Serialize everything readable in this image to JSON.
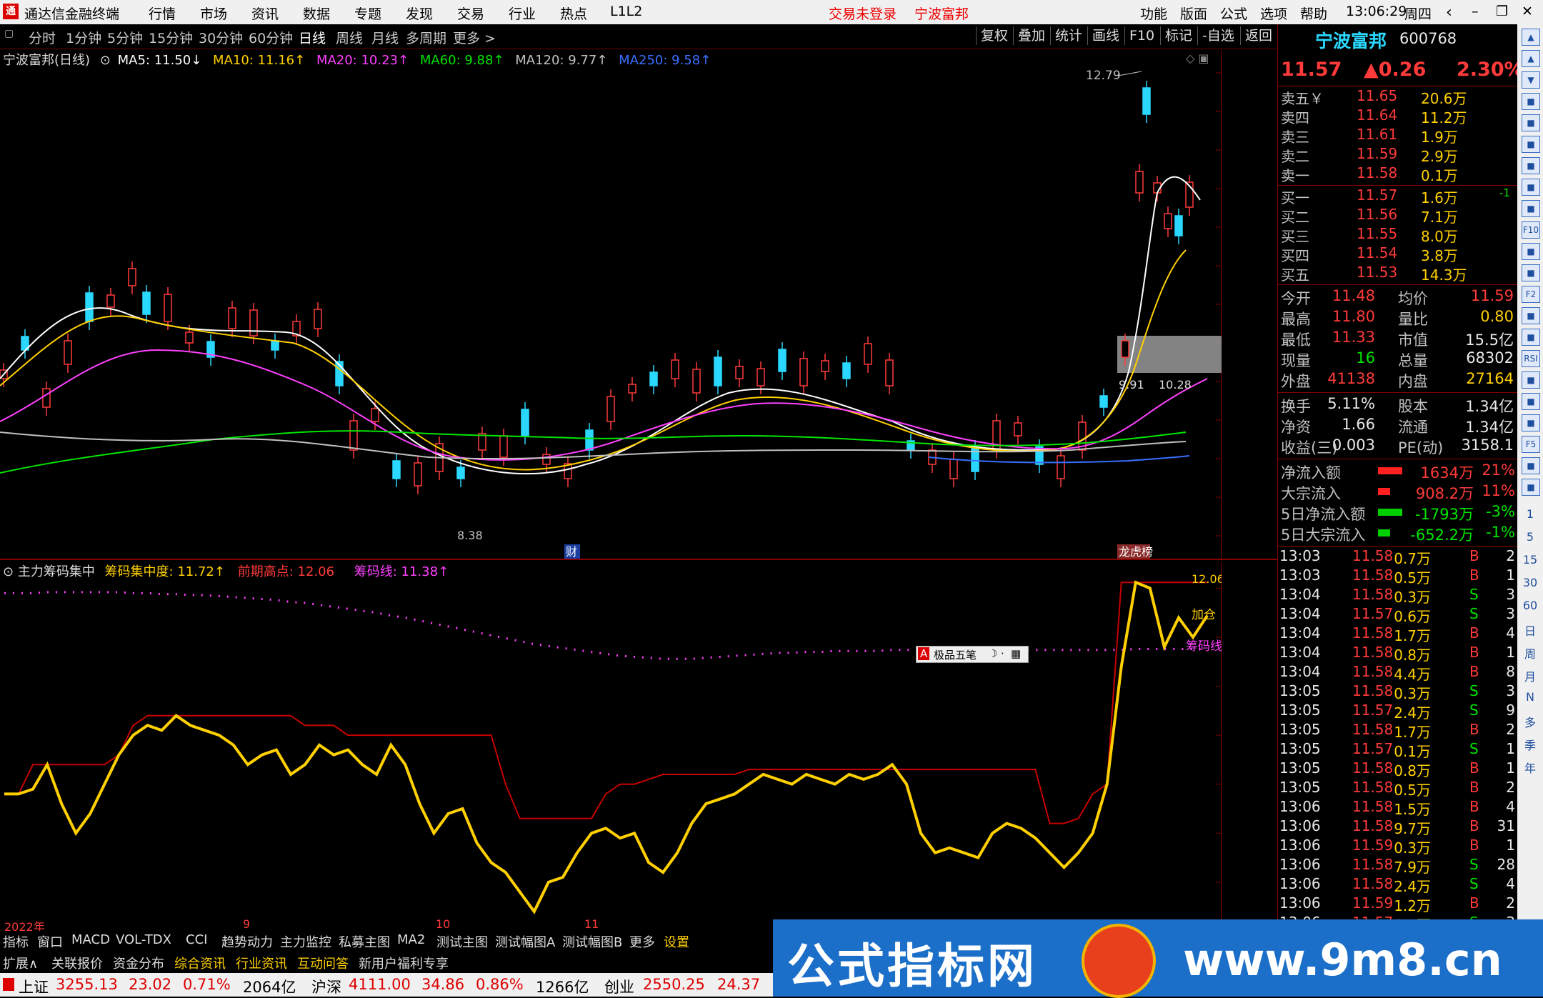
{
  "titlebar": {
    "app_name": "通达信金融终端",
    "menus": [
      "行情",
      "市场",
      "资讯",
      "数据",
      "专题",
      "发现",
      "交易",
      "行业",
      "热点",
      "L1L2"
    ],
    "notice_login": "交易未登录",
    "notice_stock": "宁波富邦",
    "right_menus": [
      "功能",
      "版面",
      "公式",
      "选项",
      "帮助"
    ],
    "time": "13:06:29",
    "weekday": "周四",
    "window_buttons": [
      "‹",
      "–",
      "❐",
      "✕"
    ]
  },
  "toolbar": {
    "periods": [
      "分时",
      "1分钟",
      "5分钟",
      "15分钟",
      "30分钟",
      "60分钟",
      "日线",
      "周线",
      "月线",
      "多周期",
      "更多 >"
    ],
    "active": "日线",
    "right_buttons": [
      "复权",
      "叠加",
      "统计",
      "画线",
      "F10",
      "标记",
      "-自选",
      "返回"
    ]
  },
  "main_chart": {
    "name": "宁波富邦(日线)",
    "ma": [
      {
        "label": "MA5: 11.50↓",
        "color": "#ffffff"
      },
      {
        "label": "MA10: 11.16↑",
        "color": "#ffd000"
      },
      {
        "label": "MA20: 10.23↑",
        "color": "#ff40ff"
      },
      {
        "label": "MA60: 9.88↑",
        "color": "#00e600"
      },
      {
        "label": "MA120: 9.77↑",
        "color": "#c0c0c0"
      },
      {
        "label": "MA250: 9.58↑",
        "color": "#3a6fff"
      }
    ],
    "high_label": "12.79",
    "low_label": "8.38",
    "box_label_left": "9.91",
    "box_label_right": "10.28",
    "event_cai": "财",
    "event_lhb": "龙虎榜",
    "y_ticks": [
      "12.50",
      "12.25",
      "12.00",
      "11.75",
      "11.50",
      "11.25",
      "11.00",
      "10.75",
      "10.50",
      "10.25",
      "10.00",
      "9.75",
      "9.50",
      "9.25",
      "9.00",
      "8.75",
      "8.50"
    ]
  },
  "indicator": {
    "name": "主力筹码集中",
    "chip_label": "筹码集中度: 11.72↑",
    "prev_high_label": "前期高点: 12.06",
    "chip_line_label": "筹码线: 11.38↑",
    "y_ticks": [
      "12.00",
      "11.50",
      "11.00",
      "10.50",
      "10.00",
      "9.50",
      "9.00"
    ],
    "end_label_top": "12.06",
    "end_label_add": "加仓",
    "end_label_line": "筹码线",
    "popup": "极品五笔"
  },
  "x_axis": {
    "labels": [
      "2022年",
      "9",
      "10",
      "11"
    ]
  },
  "quote": {
    "name": "宁波富邦",
    "code": "600768",
    "price": "11.57",
    "change": "▲0.26",
    "pct": "2.30%",
    "sells": [
      {
        "label": "卖五￥",
        "price": "11.65",
        "vol": "20.6万"
      },
      {
        "label": "卖四",
        "price": "11.64",
        "vol": "11.2万"
      },
      {
        "label": "卖三",
        "price": "11.61",
        "vol": "1.9万"
      },
      {
        "label": "卖二",
        "price": "11.59",
        "vol": "2.9万"
      },
      {
        "label": "卖一",
        "price": "11.58",
        "vol": "0.1万"
      }
    ],
    "buys": [
      {
        "label": "买一",
        "price": "11.57",
        "vol": "1.6万",
        "chg": "-1"
      },
      {
        "label": "买二",
        "price": "11.56",
        "vol": "7.1万",
        "chg": ""
      },
      {
        "label": "买三",
        "price": "11.55",
        "vol": "8.0万",
        "chg": ""
      },
      {
        "label": "买四",
        "price": "11.54",
        "vol": "3.8万",
        "chg": ""
      },
      {
        "label": "买五",
        "price": "11.53",
        "vol": "14.3万",
        "chg": ""
      }
    ],
    "stats": [
      {
        "l1": "今开",
        "v1": "11.48",
        "c1": "red",
        "l2": "均价",
        "v2": "11.59",
        "c2": "red"
      },
      {
        "l1": "最高",
        "v1": "11.80",
        "c1": "red",
        "l2": "量比",
        "v2": "0.80",
        "c2": "yel"
      },
      {
        "l1": "最低",
        "v1": "11.33",
        "c1": "red",
        "l2": "市值",
        "v2": "15.5亿",
        "c2": "wht"
      },
      {
        "l1": "现量",
        "v1": "16",
        "c1": "green",
        "l2": "总量",
        "v2": "68302",
        "c2": "wht"
      },
      {
        "l1": "外盘",
        "v1": "41138",
        "c1": "red",
        "l2": "内盘",
        "v2": "27164",
        "c2": "yel"
      }
    ],
    "stats2": [
      {
        "l1": "换手",
        "v1": "5.11%",
        "l2": "股本",
        "v2": "1.34亿"
      },
      {
        "l1": "净资",
        "v1": "1.66",
        "l2": "流通",
        "v2": "1.34亿"
      },
      {
        "l1": "收益(三)",
        "v1": "0.003",
        "l2": "PE(动)",
        "v2": "3158.1"
      }
    ],
    "flows": [
      {
        "label": "净流入额",
        "value": "1634万",
        "pct": "21%",
        "color": "red",
        "bar": 0.6
      },
      {
        "label": "大宗流入",
        "value": "908.2万",
        "pct": "11%",
        "color": "red",
        "bar": 0.3
      },
      {
        "label": "5日净流入额",
        "value": "-1793万",
        "pct": "-3%",
        "color": "green",
        "bar": 0.6
      },
      {
        "label": "5日大宗流入",
        "value": "-652.2万",
        "pct": "-1%",
        "color": "green",
        "bar": 0.3
      }
    ],
    "ticks": [
      {
        "t": "13:03",
        "p": "11.58",
        "v": "0.7万",
        "d": "B",
        "n": "2"
      },
      {
        "t": "13:03",
        "p": "11.58",
        "v": "0.5万",
        "d": "B",
        "n": "1"
      },
      {
        "t": "13:04",
        "p": "11.58",
        "v": "0.3万",
        "d": "S",
        "n": "3"
      },
      {
        "t": "13:04",
        "p": "11.57",
        "v": "0.6万",
        "d": "S",
        "n": "3"
      },
      {
        "t": "13:04",
        "p": "11.58",
        "v": "1.7万",
        "d": "B",
        "n": "4"
      },
      {
        "t": "13:04",
        "p": "11.58",
        "v": "0.8万",
        "d": "B",
        "n": "1"
      },
      {
        "t": "13:04",
        "p": "11.58",
        "v": "4.4万",
        "d": "B",
        "n": "8"
      },
      {
        "t": "13:05",
        "p": "11.58",
        "v": "0.3万",
        "d": "S",
        "n": "3"
      },
      {
        "t": "13:05",
        "p": "11.57",
        "v": "2.4万",
        "d": "S",
        "n": "9"
      },
      {
        "t": "13:05",
        "p": "11.58",
        "v": "1.7万",
        "d": "B",
        "n": "2"
      },
      {
        "t": "13:05",
        "p": "11.57",
        "v": "0.1万",
        "d": "S",
        "n": "1"
      },
      {
        "t": "13:05",
        "p": "11.58",
        "v": "0.8万",
        "d": "B",
        "n": "1"
      },
      {
        "t": "13:05",
        "p": "11.58",
        "v": "0.5万",
        "d": "B",
        "n": "2"
      },
      {
        "t": "13:06",
        "p": "11.58",
        "v": "1.5万",
        "d": "B",
        "n": "4"
      },
      {
        "t": "13:06",
        "p": "11.58",
        "v": "9.7万",
        "d": "B",
        "n": "31"
      },
      {
        "t": "13:06",
        "p": "11.59",
        "v": "0.3万",
        "d": "B",
        "n": "1"
      },
      {
        "t": "13:06",
        "p": "11.58",
        "v": "7.9万",
        "d": "S",
        "n": "28"
      },
      {
        "t": "13:06",
        "p": "11.58",
        "v": "2.4万",
        "d": "S",
        "n": "4"
      },
      {
        "t": "13:06",
        "p": "11.59",
        "v": "1.2万",
        "d": "B",
        "n": "2"
      },
      {
        "t": "13:06",
        "p": "11.57",
        "v": "0.5万",
        "d": "S",
        "n": "3"
      }
    ]
  },
  "side_icons": [
    "▲",
    "▲",
    "▼",
    "■",
    "■",
    "■",
    "■",
    "■",
    "■",
    "F10",
    "■",
    "■",
    "F2",
    "■",
    "■",
    "RSI",
    "■",
    "■",
    "■",
    "F5",
    "■",
    "■"
  ],
  "side_numbers": [
    "1",
    "5",
    "15",
    "30",
    "60",
    "日",
    "周",
    "月",
    "N",
    "多",
    "季",
    "年"
  ],
  "tabs1": [
    "指标",
    "窗口",
    "MACD",
    "VOL-TDX",
    "CCI",
    "趋势动力",
    "主力监控",
    "私募主图",
    "MA2",
    "测试主图",
    "测试幅图A",
    "测试幅图B",
    "更多",
    "设置"
  ],
  "tabs2": [
    {
      "label": "扩展∧",
      "color": "#ddd"
    },
    {
      "label": "关联报价",
      "color": "#ddd"
    },
    {
      "label": "资金分布",
      "color": "#ddd"
    },
    {
      "label": "综合资讯",
      "color": "#ffd000"
    },
    {
      "label": "行业资讯",
      "color": "#ffd000"
    },
    {
      "label": "互动问答",
      "color": "#ffd000"
    },
    {
      "label": "新用户福利专享",
      "color": "#ddd"
    }
  ],
  "status": {
    "sh_name": "上证",
    "sh_val": "3255.13",
    "sh_chg": "23.02",
    "sh_pct": "0.71%",
    "sh_amt": "2064亿",
    "hs_name": "沪深",
    "hs_val": "4111.00",
    "hs_chg": "34.86",
    "hs_pct": "0.86%",
    "hs_amt": "1266亿",
    "cy_name": "创业",
    "cy_val": "2550.25",
    "cy_chg": "24.37"
  },
  "watermark": {
    "cn": "公式指标网",
    "url": "www.9m8.cn"
  },
  "chart_data": {
    "type": "line",
    "title": "",
    "series": [
      {
        "name": "筹码集中度",
        "values": [
          9.9,
          9.9,
          9.95,
          10.2,
          9.8,
          9.5,
          9.7,
          10.0,
          10.3,
          10.5,
          10.6,
          10.55,
          10.7,
          10.6,
          10.55,
          10.5,
          10.4,
          10.2,
          10.3,
          10.35,
          10.1,
          10.2,
          10.4,
          10.3,
          10.35,
          10.2,
          10.1,
          10.4,
          10.2,
          9.8,
          9.5,
          9.7,
          9.75,
          9.4,
          9.2,
          9.1,
          8.9,
          8.7,
          9.0,
          9.05,
          9.3,
          9.5,
          9.55,
          9.45,
          9.5,
          9.2,
          9.1,
          9.3,
          9.6,
          9.8,
          9.85,
          9.9,
          10.0,
          10.1,
          10.05,
          10.0,
          10.1,
          10.05,
          10.0,
          10.1,
          10.05,
          10.1,
          10.2,
          10.0,
          9.5,
          9.3,
          9.35,
          9.3,
          9.25,
          9.5,
          9.6,
          9.55,
          9.45,
          9.3,
          9.15,
          9.3,
          9.5,
          10.0,
          11.2,
          12.06,
          12.0,
          11.4,
          11.7,
          11.5,
          11.72
        ]
      },
      {
        "name": "前期高点",
        "values": [
          9.9,
          9.9,
          10.2,
          10.2,
          10.2,
          10.2,
          10.2,
          10.2,
          10.3,
          10.6,
          10.7,
          10.7,
          10.7,
          10.7,
          10.7,
          10.7,
          10.7,
          10.7,
          10.7,
          10.7,
          10.7,
          10.6,
          10.6,
          10.6,
          10.5,
          10.5,
          10.5,
          10.5,
          10.5,
          10.5,
          10.5,
          10.5,
          10.5,
          10.5,
          10.5,
          10.0,
          9.65,
          9.65,
          9.65,
          9.65,
          9.65,
          9.65,
          9.9,
          10.0,
          10.0,
          10.05,
          10.1,
          10.1,
          10.1,
          10.1,
          10.1,
          10.1,
          10.15,
          10.15,
          10.15,
          10.15,
          10.15,
          10.15,
          10.15,
          10.15,
          10.15,
          10.15,
          10.15,
          10.15,
          10.15,
          10.15,
          10.15,
          10.15,
          10.15,
          10.15,
          10.15,
          10.15,
          10.15,
          9.6,
          9.6,
          9.65,
          9.9,
          10.0,
          12.06,
          12.06,
          12.06,
          12.06,
          12.06,
          12.06,
          12.06
        ]
      },
      {
        "name": "筹码线",
        "values": [
          11.95,
          11.95,
          11.95,
          11.96,
          11.96,
          11.96,
          11.96,
          11.96,
          11.96,
          11.95,
          11.95,
          11.94,
          11.94,
          11.93,
          11.93,
          11.92,
          11.91,
          11.9,
          11.89,
          11.88,
          11.86,
          11.85,
          11.83,
          11.81,
          11.79,
          11.77,
          11.75,
          11.72,
          11.7,
          11.67,
          11.64,
          11.61,
          11.58,
          11.55,
          11.52,
          11.49,
          11.46,
          11.43,
          11.41,
          11.39,
          11.37,
          11.35,
          11.33,
          11.31,
          11.3,
          11.29,
          11.28,
          11.28,
          11.28,
          11.29,
          11.3,
          11.31,
          11.32,
          11.33,
          11.34,
          11.34,
          11.35,
          11.35,
          11.36,
          11.36,
          11.36,
          11.36,
          11.37,
          11.37,
          11.37,
          11.37,
          11.37,
          11.37,
          11.37,
          11.37,
          11.37,
          11.37,
          11.37,
          11.37,
          11.37,
          11.37,
          11.37,
          11.37,
          11.37,
          11.38,
          11.38,
          11.38,
          11.38,
          11.38,
          11.38
        ]
      }
    ],
    "ylim": [
      8.7,
      12.2
    ],
    "y_ticks": [
      9.0,
      9.5,
      10.0,
      10.5,
      11.0,
      11.5,
      12.0
    ]
  }
}
